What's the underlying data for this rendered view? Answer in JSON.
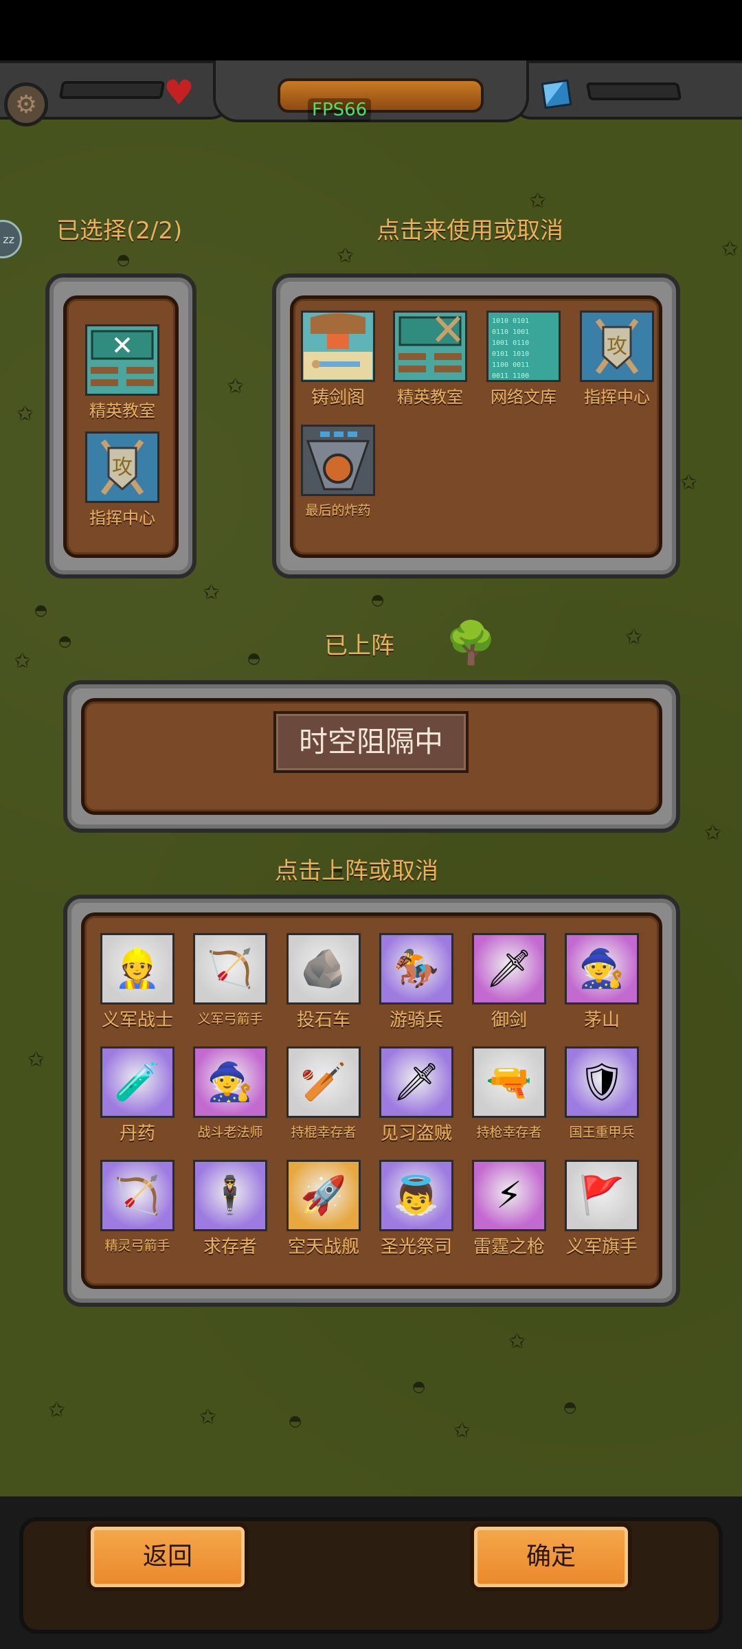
{
  "hud": {
    "fps": "FPS66",
    "icons": [
      "gear-icon",
      "heart-icon",
      "cube-icon"
    ],
    "side_badge": "zz"
  },
  "selected": {
    "title": "已选择(2/2)",
    "items": [
      {
        "label": "精英教室",
        "icon": "classroom",
        "bg": "#4aa7a0"
      },
      {
        "label": "指挥中心",
        "icon": "command-center",
        "bg": "#3a7fa8"
      }
    ]
  },
  "available": {
    "title": "点击来使用或取消",
    "items": [
      {
        "label": "铸剑阁",
        "icon": "forge",
        "bg": "#5fb4b8"
      },
      {
        "label": "精英教室",
        "icon": "classroom",
        "bg": "#4aa7a0"
      },
      {
        "label": "网络文库",
        "icon": "network-library",
        "bg": "#3aa69a"
      },
      {
        "label": "指挥中心",
        "icon": "command-center",
        "bg": "#3a7fa8"
      },
      {
        "label": "最后的炸药",
        "icon": "dynamite",
        "bg": "#4e5660"
      }
    ]
  },
  "deployed": {
    "title": "已上阵",
    "tag": "时空阻隔中"
  },
  "units": {
    "title": "点击上阵或取消",
    "items": [
      {
        "label": "义军战士",
        "glyph": "👷",
        "bg": "#cfcfcf"
      },
      {
        "label": "义军弓箭手",
        "glyph": "🏹",
        "bg": "#cfcfcf"
      },
      {
        "label": "投石车",
        "glyph": "🪨",
        "bg": "#cfcfcf"
      },
      {
        "label": "游骑兵",
        "glyph": "🏇",
        "bg": "#9d7be0"
      },
      {
        "label": "御剑",
        "glyph": "🗡",
        "bg": "#c36ad0"
      },
      {
        "label": "茅山",
        "glyph": "🧙",
        "bg": "#c36ad0"
      },
      {
        "label": "丹药",
        "glyph": "🧪",
        "bg": "#9d7be0"
      },
      {
        "label": "战斗老法师",
        "glyph": "🧙",
        "bg": "#c36ad0"
      },
      {
        "label": "持棍幸存者",
        "glyph": "🏏",
        "bg": "#cfcfcf"
      },
      {
        "label": "见习盗贼",
        "glyph": "🗡",
        "bg": "#9d7be0"
      },
      {
        "label": "持枪幸存者",
        "glyph": "🔫",
        "bg": "#cfcfcf"
      },
      {
        "label": "国王重甲兵",
        "glyph": "🛡",
        "bg": "#9d7be0"
      },
      {
        "label": "精灵弓箭手",
        "glyph": "🏹",
        "bg": "#9d7be0"
      },
      {
        "label": "求存者",
        "glyph": "🕴",
        "bg": "#9d7be0"
      },
      {
        "label": "空天战舰",
        "glyph": "🚀",
        "bg": "#e8a840"
      },
      {
        "label": "圣光祭司",
        "glyph": "👼",
        "bg": "#9d7be0"
      },
      {
        "label": "雷霆之枪",
        "glyph": "⚡",
        "bg": "#c36ad0"
      },
      {
        "label": "义军旗手",
        "glyph": "🚩",
        "bg": "#cfcfcf"
      }
    ]
  },
  "buttons": {
    "back": "返回",
    "confirm": "确定"
  }
}
